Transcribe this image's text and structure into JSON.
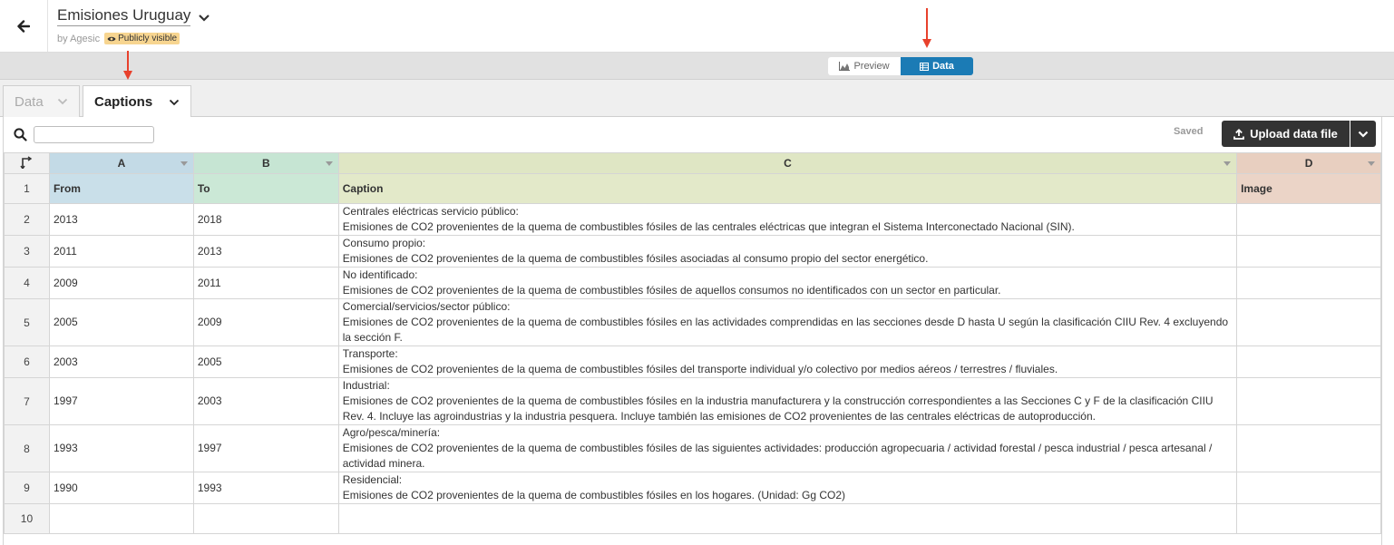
{
  "header": {
    "title": "Emisiones Uruguay",
    "byline": "by Agesic",
    "badge": "Publicly visible"
  },
  "view_toggle": {
    "preview_label": "Preview",
    "data_label": "Data",
    "active": "Data"
  },
  "sheet_tabs": [
    {
      "label": "Data",
      "active": false
    },
    {
      "label": "Captions",
      "active": true
    }
  ],
  "toolbar": {
    "search_placeholder": "",
    "status": "Saved",
    "upload_label": "Upload data file"
  },
  "columns": [
    "A",
    "B",
    "C",
    "D"
  ],
  "rows": [
    {
      "num": "1",
      "cells": [
        "From",
        "To",
        "Caption",
        "Image"
      ]
    },
    {
      "num": "2",
      "cells": [
        "2013",
        "2018",
        "Centrales eléctricas servicio público:\nEmisiones de CO2 provenientes de la quema de combustibles fósiles de las centrales eléctricas que integran el Sistema Interconectado Nacional (SIN).",
        ""
      ]
    },
    {
      "num": "3",
      "cells": [
        "2011",
        "2013",
        "Consumo propio:\nEmisiones de CO2 provenientes de la quema de combustibles fósiles asociadas al consumo propio del sector energético.",
        ""
      ]
    },
    {
      "num": "4",
      "cells": [
        "2009",
        "2011",
        "No identificado:\nEmisiones de CO2 provenientes de la quema de combustibles fósiles de aquellos consumos no identificados con un sector en particular.",
        ""
      ]
    },
    {
      "num": "5",
      "cells": [
        "2005",
        "2009",
        "Comercial/servicios/sector público:\nEmisiones de CO2 provenientes de la quema de combustibles fósiles en las actividades comprendidas en las secciones desde D hasta U según la clasificación CIIU Rev. 4 excluyendo la sección F.",
        ""
      ]
    },
    {
      "num": "6",
      "cells": [
        "2003",
        "2005",
        "Transporte:\nEmisiones de CO2 provenientes de la quema de combustibles fósiles del transporte individual y/o colectivo por medios aéreos / terrestres / fluviales.",
        ""
      ]
    },
    {
      "num": "7",
      "cells": [
        "1997",
        "2003",
        "Industrial:\nEmisiones de CO2 provenientes de la quema de combustibles fósiles en la industria manufacturera y la construcción correspondientes a las Secciones C y F de la clasificación CIIU Rev. 4. Incluye las agroindustrias y la industria pesquera. Incluye también las emisiones de CO2 provenientes de las centrales eléctricas de autoproducción.",
        ""
      ]
    },
    {
      "num": "8",
      "cells": [
        "1993",
        "1997",
        "Agro/pesca/minería:\nEmisiones de CO2 provenientes de la quema de combustibles fósiles de las siguientes actividades: producción agropecuaria / actividad forestal / pesca industrial / pesca artesanal / actividad minera.",
        ""
      ]
    },
    {
      "num": "9",
      "cells": [
        "1990",
        "1993",
        "Residencial:\nEmisiones de CO2 provenientes de la quema de combustibles fósiles en los hogares. (Unidad: Gg CO2)",
        ""
      ]
    },
    {
      "num": "10",
      "cells": [
        "",
        "",
        "",
        ""
      ]
    }
  ],
  "colors": {
    "accent": "#1b7bb5",
    "badge": "#f7d590",
    "arrow": "#e8412c"
  }
}
